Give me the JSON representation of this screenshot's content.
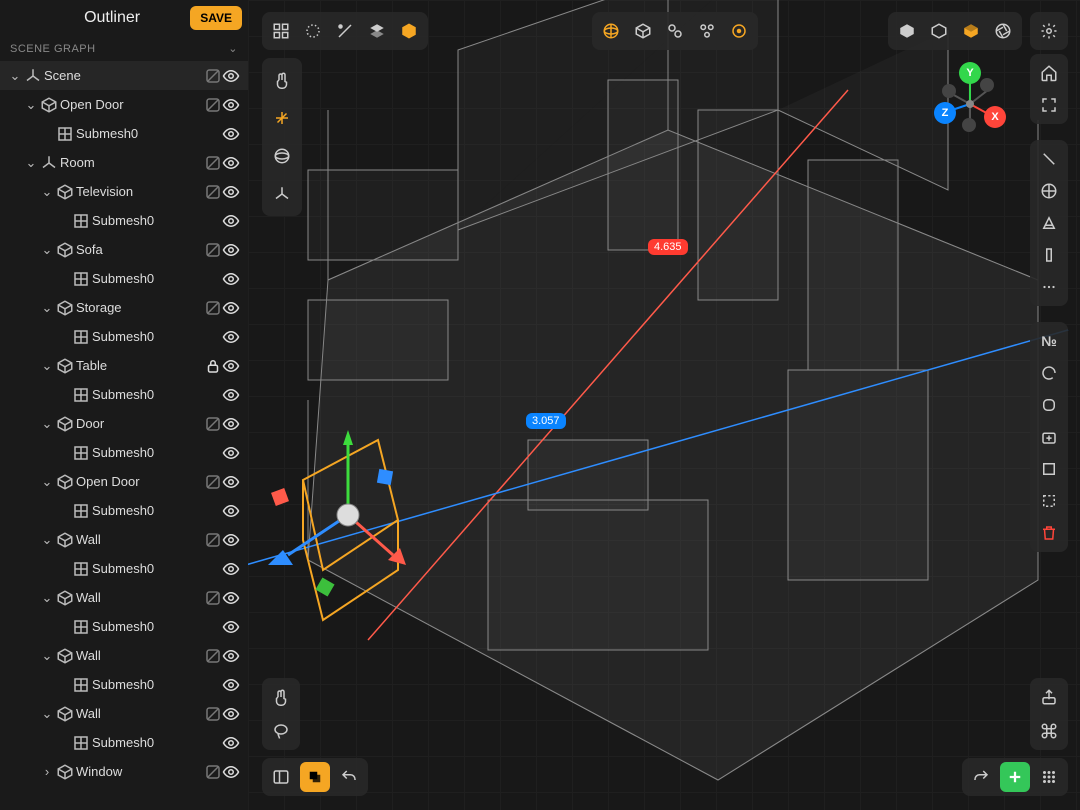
{
  "outliner": {
    "title": "Outliner",
    "save": "SAVE",
    "section": "SCENE GRAPH",
    "tree": [
      {
        "indent": 0,
        "disc": "v",
        "icon": "axis",
        "label": "Scene",
        "shaderOff": true,
        "eye": true,
        "scene": true
      },
      {
        "indent": 1,
        "disc": "v",
        "icon": "cube",
        "label": "Open Door",
        "shaderOff": true,
        "eye": true
      },
      {
        "indent": 2,
        "disc": "",
        "icon": "mesh",
        "label": "Submesh0",
        "eye": true
      },
      {
        "indent": 1,
        "disc": "v",
        "icon": "axis",
        "label": "Room",
        "shaderOff": true,
        "eye": true
      },
      {
        "indent": 2,
        "disc": "v",
        "icon": "cube",
        "label": "Television",
        "shaderOff": true,
        "eye": true
      },
      {
        "indent": 3,
        "disc": "",
        "icon": "mesh",
        "label": "Submesh0",
        "eye": true
      },
      {
        "indent": 2,
        "disc": "v",
        "icon": "cube",
        "label": "Sofa",
        "shaderOff": true,
        "eye": true
      },
      {
        "indent": 3,
        "disc": "",
        "icon": "mesh",
        "label": "Submesh0",
        "eye": true
      },
      {
        "indent": 2,
        "disc": "v",
        "icon": "cube",
        "label": "Storage",
        "shaderOff": true,
        "eye": true
      },
      {
        "indent": 3,
        "disc": "",
        "icon": "mesh",
        "label": "Submesh0",
        "eye": true
      },
      {
        "indent": 2,
        "disc": "v",
        "icon": "cube",
        "label": "Table",
        "lock": true,
        "eye": true
      },
      {
        "indent": 3,
        "disc": "",
        "icon": "mesh",
        "label": "Submesh0",
        "eye": true
      },
      {
        "indent": 2,
        "disc": "v",
        "icon": "cube",
        "label": "Door",
        "shaderOff": true,
        "eye": true
      },
      {
        "indent": 3,
        "disc": "",
        "icon": "mesh",
        "label": "Submesh0",
        "eye": true
      },
      {
        "indent": 2,
        "disc": "v",
        "icon": "cube",
        "label": "Open Door",
        "shaderOff": true,
        "eye": true
      },
      {
        "indent": 3,
        "disc": "",
        "icon": "mesh",
        "label": "Submesh0",
        "eye": true
      },
      {
        "indent": 2,
        "disc": "v",
        "icon": "cube",
        "label": "Wall",
        "shaderOff": true,
        "eye": true
      },
      {
        "indent": 3,
        "disc": "",
        "icon": "mesh",
        "label": "Submesh0",
        "eye": true
      },
      {
        "indent": 2,
        "disc": "v",
        "icon": "cube",
        "label": "Wall",
        "shaderOff": true,
        "eye": true
      },
      {
        "indent": 3,
        "disc": "",
        "icon": "mesh",
        "label": "Submesh0",
        "eye": true
      },
      {
        "indent": 2,
        "disc": "v",
        "icon": "cube",
        "label": "Wall",
        "shaderOff": true,
        "eye": true
      },
      {
        "indent": 3,
        "disc": "",
        "icon": "mesh",
        "label": "Submesh0",
        "eye": true
      },
      {
        "indent": 2,
        "disc": "v",
        "icon": "cube",
        "label": "Wall",
        "shaderOff": true,
        "eye": true
      },
      {
        "indent": 3,
        "disc": "",
        "icon": "mesh",
        "label": "Submesh0",
        "eye": true
      },
      {
        "indent": 2,
        "disc": ">",
        "icon": "cube",
        "label": "Window",
        "shaderOff": true,
        "eye": true
      }
    ]
  },
  "viewport": {
    "dimensions": {
      "red": "4.635",
      "blue": "3.057"
    },
    "axis_labels": {
      "x": "X",
      "y": "Y",
      "z": "Z"
    },
    "right_label_nom": "№"
  },
  "icons": {
    "grid4": "grid-icon",
    "hex": "hex-icon",
    "slash": "divide-icon",
    "stack": "stack-icon",
    "globe": "globe-icon",
    "cube": "cube-icon",
    "links": "link-icon",
    "links2": "link-chain-icon",
    "target": "target-icon",
    "gear": "gear-icon",
    "home": "home-icon",
    "frame": "fullscreen-icon",
    "hand": "hand-icon",
    "gizmo": "gizmo-icon",
    "sphere": "sphere-icon",
    "axes": "axes-icon",
    "lasso": "lasso-icon",
    "panel": "panel-icon",
    "layers": "layers-icon",
    "undo": "undo-icon",
    "redo": "redo-icon",
    "plus": "plus-icon",
    "menu": "menu-dots-icon",
    "share": "share-icon",
    "cmd": "command-icon",
    "trash": "trash-icon"
  }
}
